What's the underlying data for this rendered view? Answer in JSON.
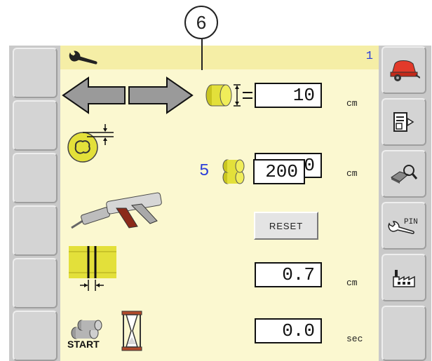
{
  "callout": {
    "number": "6"
  },
  "header": {
    "icon": "wrench-icon",
    "page": "1"
  },
  "rows": [
    {
      "name": "bale-diameter",
      "icon": "bale-size-icon",
      "value": "10",
      "unit": "cm"
    },
    {
      "name": "knife-pressure",
      "icon": "knife-gap-icon",
      "value": "0",
      "unit": "cm"
    },
    {
      "name": "lubrication",
      "icon": "grease-gun-icon",
      "count": "5",
      "value": "200",
      "reset_label": "RESET"
    },
    {
      "name": "net-overlap",
      "icon": "net-overlap-icon",
      "value": "0.7",
      "unit": "cm"
    },
    {
      "name": "start-delay",
      "icon": "hourglass-icon",
      "start_label": "START",
      "value": "0.0",
      "unit": "sec"
    }
  ],
  "sidebar_right": [
    "baler-icon",
    "document-export-icon",
    "eraser-search-icon",
    "wrench-pin-icon",
    "factory-icon"
  ],
  "pin_label": "PIN",
  "colors": {
    "panel": "#fbf8d0",
    "header": "#f5eea6",
    "accent_blue": "#2a3dd9",
    "bale_yellow": "#e3e03a"
  }
}
